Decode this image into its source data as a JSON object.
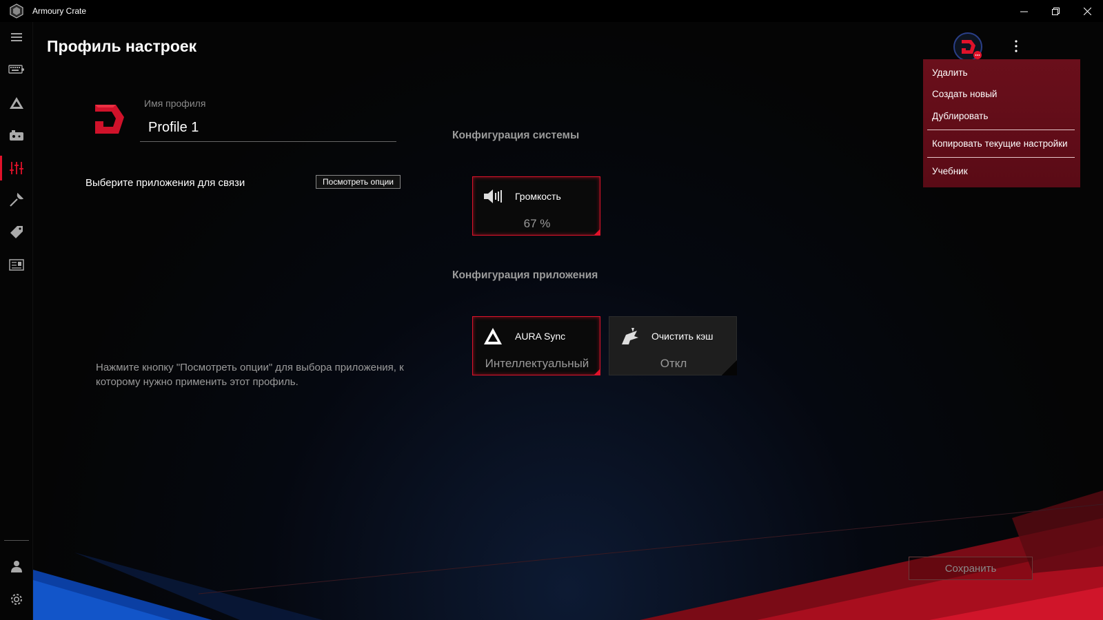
{
  "window": {
    "title": "Armoury Crate"
  },
  "page": {
    "title": "Профиль настроек"
  },
  "sidebar": {
    "items": [
      {
        "icon": "menu-icon"
      },
      {
        "icon": "keyboard-device-icon"
      },
      {
        "icon": "aura-icon"
      },
      {
        "icon": "game-device-icon"
      },
      {
        "icon": "scenario-profiles-icon",
        "active": true
      },
      {
        "icon": "tools-icon"
      },
      {
        "icon": "deals-tag-icon"
      },
      {
        "icon": "news-icon"
      },
      {
        "icon": "user-icon"
      },
      {
        "icon": "settings-gear-icon"
      }
    ]
  },
  "profile": {
    "name_label": "Имя профиля",
    "name_value": "Profile 1",
    "apps_label": "Выберите приложения для связи",
    "view_options_label": "Посмотреть опции",
    "hint": "Нажмите кнопку \"Посмотреть опции\" для выбора приложения, к которому нужно применить этот профиль."
  },
  "system_config": {
    "heading": "Конфигурация системы",
    "tiles": [
      {
        "name": "Громкость",
        "value": "67 %",
        "icon": "speaker-icon"
      }
    ]
  },
  "app_config": {
    "heading": "Конфигурация приложения",
    "tiles": [
      {
        "name": "AURA Sync",
        "value": "Интеллектуальный",
        "icon": "aura-sync-icon"
      },
      {
        "name": "Очистить кэш",
        "value": "Откл",
        "icon": "clear-cache-icon"
      }
    ]
  },
  "menu": {
    "items": [
      "Удалить",
      "Создать новый",
      "Дублировать",
      "Копировать текущие настройки",
      "Учебник"
    ]
  },
  "actions": {
    "save_label": "Сохранить"
  },
  "colors": {
    "accent": "#e0122a",
    "menu_bg": "#5e0d18",
    "background": "#000000"
  }
}
